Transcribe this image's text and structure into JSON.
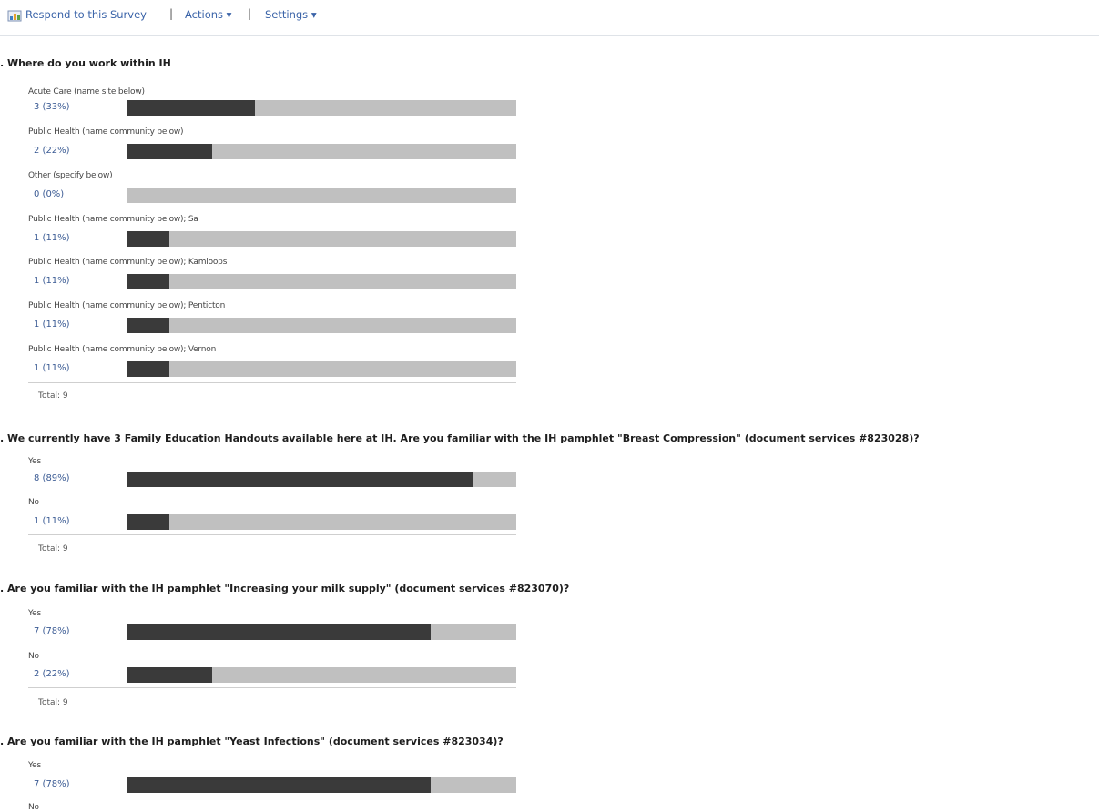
{
  "toolbar": {
    "respond_label": "Respond to this Survey",
    "separator": "|",
    "actions_label": "Actions ▾",
    "settings_label": "Settings ▾",
    "icon": "survey-icon"
  },
  "colors": {
    "bar_track": "#c0c0c0",
    "bar_fill": "#3a3a3a",
    "link": "#3b5b94"
  },
  "questions": [
    {
      "title": ". Where do you work within IH",
      "answers": [
        {
          "label": "Acute Care (name site below)",
          "count": "3 (33%)",
          "fraction": 0.33
        },
        {
          "label": "Public Health (name community below)",
          "count": "2 (22%)",
          "fraction": 0.22
        },
        {
          "label": "Other (specify below)",
          "count": "0 (0%)",
          "fraction": 0
        },
        {
          "label": "Public Health (name community below); Sa",
          "count": "1 (11%)",
          "fraction": 0.11
        },
        {
          "label": "Public Health (name community below); Kamloops",
          "count": "1 (11%)",
          "fraction": 0.11
        },
        {
          "label": "Public Health (name community below); Penticton",
          "count": "1 (11%)",
          "fraction": 0.11
        },
        {
          "label": "Public Health (name community below); Vernon",
          "count": "1 (11%)",
          "fraction": 0.11
        }
      ],
      "total": "Total: 9"
    },
    {
      "title": ". We currently have 3 Family Education Handouts available here at IH. Are you familiar with the IH pamphlet \"Breast Compression\" (document services #823028)?",
      "answers": [
        {
          "label": "Yes",
          "count": "8 (89%)",
          "fraction": 0.89
        },
        {
          "label": "No",
          "count": "1 (11%)",
          "fraction": 0.11
        }
      ],
      "total": "Total: 9"
    },
    {
      "title": ". Are you familiar with the IH pamphlet \"Increasing your milk supply\" (document services #823070)?",
      "answers": [
        {
          "label": "Yes",
          "count": "7 (78%)",
          "fraction": 0.78
        },
        {
          "label": "No",
          "count": "2 (22%)",
          "fraction": 0.22
        }
      ],
      "total": "Total: 9"
    },
    {
      "title": ". Are you familiar with the IH pamphlet \"Yeast Infections\" (document services #823034)?",
      "answers": [
        {
          "label": "Yes",
          "count": "7 (78%)",
          "fraction": 0.78
        },
        {
          "label": "No",
          "count": "",
          "fraction": null
        }
      ],
      "total": ""
    }
  ]
}
